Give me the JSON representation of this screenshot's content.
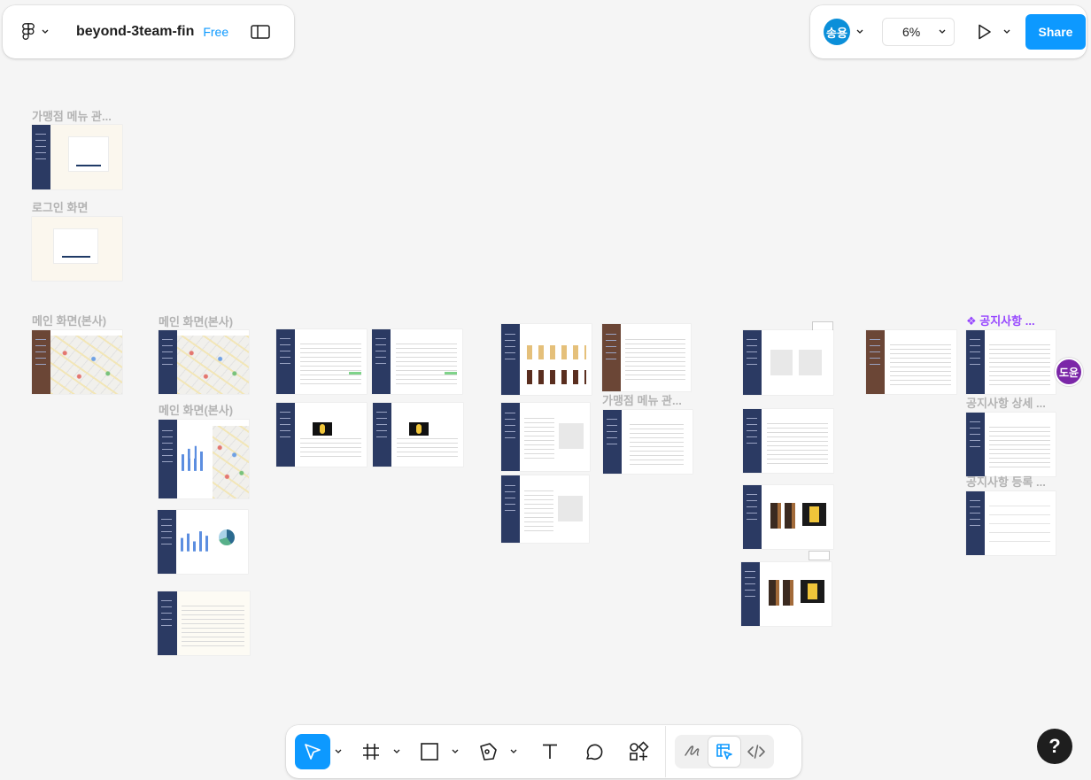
{
  "toolbar": {
    "file_name": "beyond-3team-fin",
    "plan": "Free",
    "avatar_initials": "송용",
    "zoom": "6%",
    "share_label": "Share",
    "accent": "#0d99ff"
  },
  "canvas": {
    "labels": {
      "franchise_menu_1": "가맹점 메뉴 관...",
      "login": "로그인 화면",
      "main_hq_1": "메인 화면(본사)",
      "main_hq_2": "메인 화면(본사)",
      "main_hq_3": "메인 화면(본사)",
      "franchise_menu_2": "가맹점 메뉴 관...",
      "notice": "❖ 공지사항 ...",
      "notice_detail": "공지사항 상세 ...",
      "notice_register": "공지사항 등록 ..."
    },
    "collaborator": "도윤"
  },
  "help": {
    "label": "?"
  }
}
